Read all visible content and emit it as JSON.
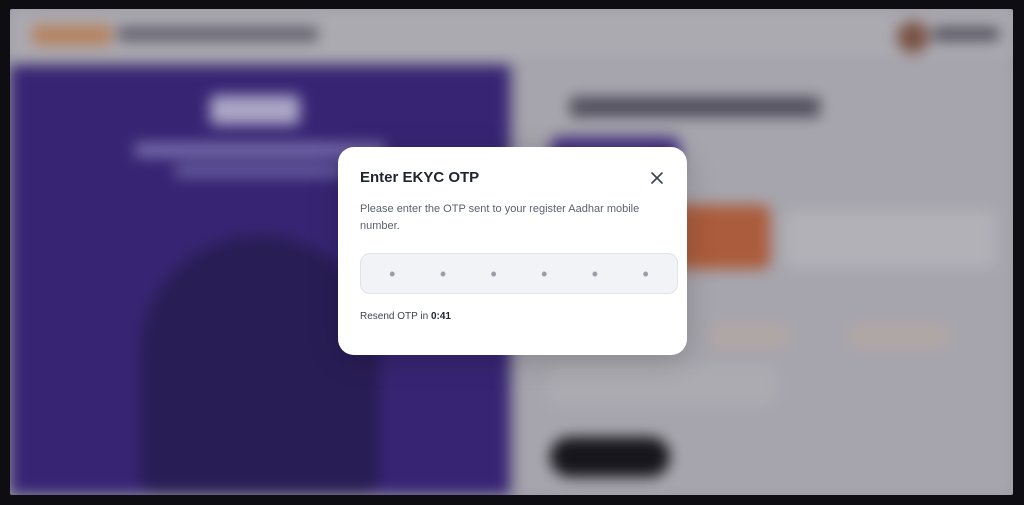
{
  "modal": {
    "title": "Enter EKYC OTP",
    "description": "Please enter the OTP sent to your register Aadhar mobile number.",
    "otp_placeholder": [
      "•",
      "•",
      "•",
      "•",
      "•",
      "•"
    ],
    "resend_label": "Resend OTP in ",
    "resend_timer": "0:41",
    "close_icon": "close-icon"
  },
  "colors": {
    "banner": "#3b2682",
    "modal_bg": "#ffffff",
    "title": "#1f2430"
  }
}
